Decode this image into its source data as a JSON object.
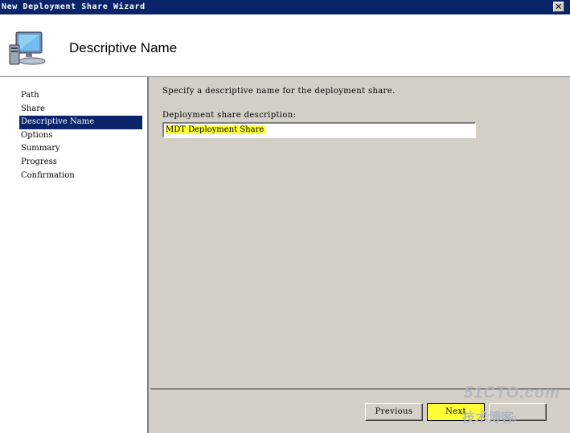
{
  "window": {
    "title": "New Deployment Share Wizard",
    "close_glyph": "✕"
  },
  "header": {
    "title": "Descriptive Name",
    "icon": "computer-icon"
  },
  "sidebar": {
    "items": [
      {
        "label": "Path"
      },
      {
        "label": "Share"
      },
      {
        "label": "Descriptive Name",
        "selected": true
      },
      {
        "label": "Options"
      },
      {
        "label": "Summary"
      },
      {
        "label": "Progress"
      },
      {
        "label": "Confirmation"
      }
    ]
  },
  "main": {
    "instructions": "Specify a descriptive name for the deployment share.",
    "field_label": "Deployment share description:",
    "field_value": "MDT Deployment Share"
  },
  "buttons": {
    "previous": "Previous",
    "next": "Next",
    "cancel": ""
  },
  "watermark": {
    "line1": "51CTO.com",
    "line2": "技术博客",
    "line3": "Blog"
  },
  "colors": {
    "titlebar": "#0a246a",
    "selection": "#0a246a",
    "highlight": "#ffff33",
    "face": "#d4d0c8"
  }
}
